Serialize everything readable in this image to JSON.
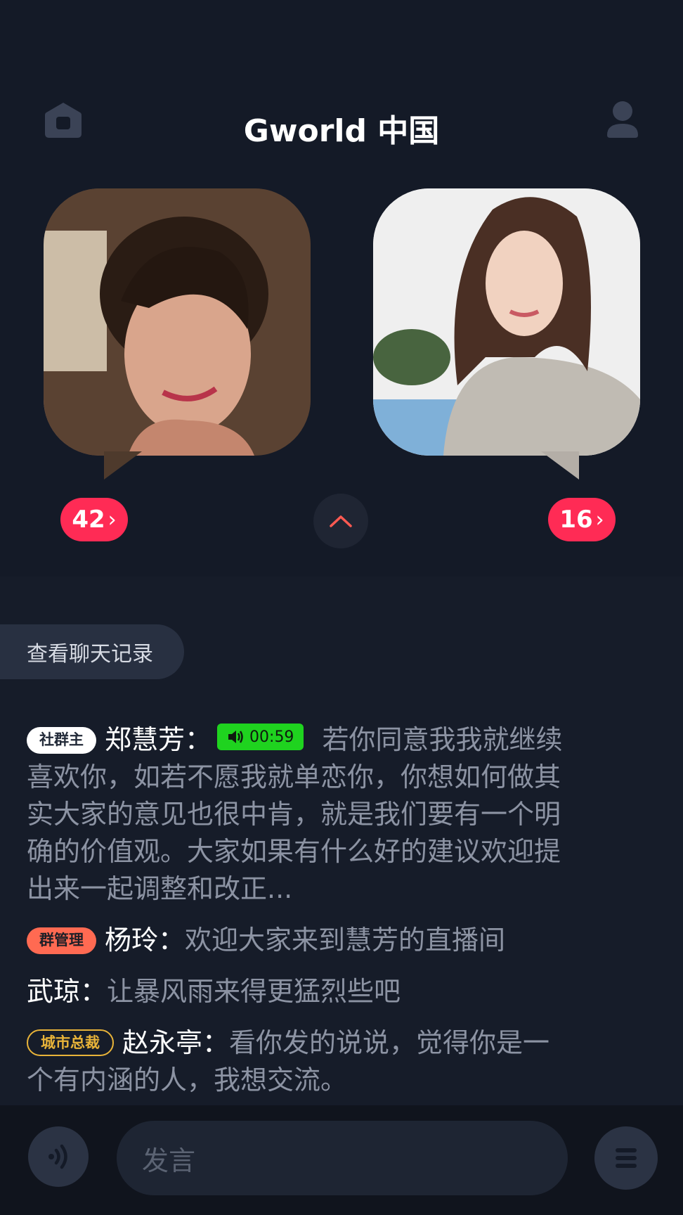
{
  "header": {
    "title": "Gworld 中国",
    "home_icon": "home-icon",
    "profile_icon": "user-icon"
  },
  "stage": {
    "left": {
      "count": "42",
      "avatar": "host-avatar-photo"
    },
    "right": {
      "count": "16",
      "avatar": "guest-avatar-photo"
    },
    "collapse_icon": "chevron-up-icon"
  },
  "history_button": "查看聊天记录",
  "messages": [
    {
      "role": "社群主",
      "name": "郑慧芳",
      "sep": "：",
      "voice_duration": "00:59",
      "text": "若你同意我我就继续喜欢你，如若不愿我就单恋你，你想如何做其实大家的意见也很中肯，就是我们要有一个明确的价值观。大家如果有什么好的建议欢迎提出来一起调整和改正..."
    },
    {
      "role": "群管理",
      "name": "杨玲",
      "sep": "：",
      "text": "欢迎大家来到慧芳的直播间"
    },
    {
      "name": "武琼",
      "sep": "：",
      "text": "让暴风雨来得更猛烈些吧"
    },
    {
      "role": "城市总裁",
      "name": "赵永亭",
      "sep": "：",
      "text": "看你发的说说，觉得你是一个有内涵的人，我想交流。"
    }
  ],
  "composer": {
    "placeholder": "发言",
    "voice_icon": "voice-wave-icon",
    "menu_icon": "menu-icon"
  },
  "colors": {
    "background": "#161c29",
    "badge": "#ff2b55",
    "owner_tag": "#ffffff",
    "admin_tag": "#ff6a52",
    "city_tag": "#e8b339",
    "voice_chip": "#1fd31f",
    "muted_text": "#8c93a3"
  }
}
